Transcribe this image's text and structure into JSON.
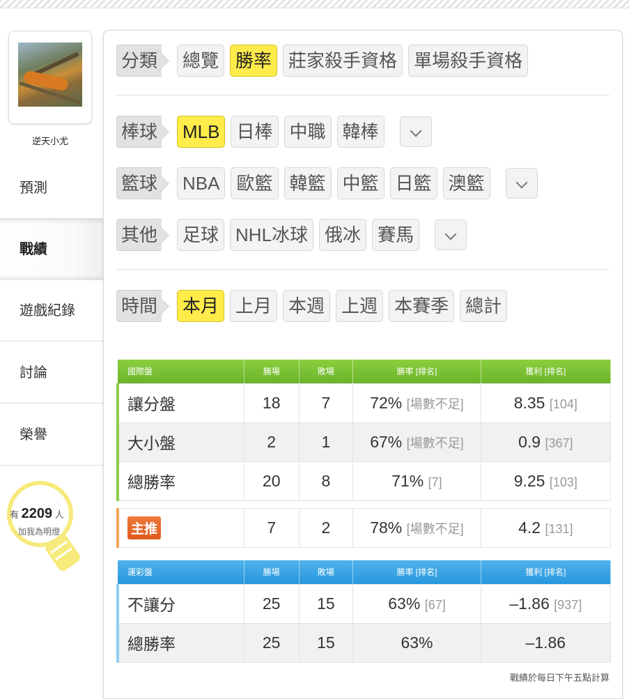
{
  "sidebar": {
    "username": "逆天小尤",
    "nav": [
      "預測",
      "戰績",
      "遊戲紀錄",
      "討論",
      "榮譽"
    ],
    "light": {
      "prefix": "有",
      "count": "2209",
      "suffix": "人",
      "caption": "加我為明燈"
    }
  },
  "filters": {
    "category": {
      "label": "分類",
      "options": [
        "總覽",
        "勝率",
        "莊家殺手資格",
        "單場殺手資格"
      ],
      "active": "勝率"
    },
    "baseball": {
      "label": "棒球",
      "options": [
        "MLB",
        "日棒",
        "中職",
        "韓棒"
      ],
      "active": "MLB"
    },
    "basketball": {
      "label": "籃球",
      "options": [
        "NBA",
        "歐籃",
        "韓籃",
        "中籃",
        "日籃",
        "澳籃"
      ]
    },
    "other": {
      "label": "其他",
      "options": [
        "足球",
        "NHL冰球",
        "俄冰",
        "賽馬"
      ]
    },
    "time": {
      "label": "時間",
      "options": [
        "本月",
        "上月",
        "本週",
        "上週",
        "本賽季",
        "總計"
      ],
      "active": "本月"
    }
  },
  "intl_table": {
    "headers": [
      "國際盤",
      "勝場",
      "敗場",
      "勝率 [排名]",
      "獲利 [排名]"
    ],
    "rows": [
      {
        "name": "讓分盤",
        "win": "18",
        "loss": "7",
        "rate": "72%",
        "rate_rank": "[場數不足]",
        "profit": "8.35",
        "profit_rank": "[104]"
      },
      {
        "name": "大小盤",
        "win": "2",
        "loss": "1",
        "rate": "67%",
        "rate_rank": "[場數不足]",
        "profit": "0.9",
        "profit_rank": "[367]"
      },
      {
        "name": "總勝率",
        "win": "20",
        "loss": "8",
        "rate": "71%",
        "rate_rank": "[7]",
        "profit": "9.25",
        "profit_rank": "[103]"
      }
    ]
  },
  "featured": {
    "badge": "主推",
    "win": "7",
    "loss": "2",
    "rate": "78%",
    "rate_rank": "[場數不足]",
    "profit": "4.2",
    "profit_rank": "[131]"
  },
  "lottery_table": {
    "headers": [
      "運彩盤",
      "勝場",
      "敗場",
      "勝率 [排名]",
      "獲利 [排名]"
    ],
    "rows": [
      {
        "name": "不讓分",
        "win": "25",
        "loss": "15",
        "rate": "63%",
        "rate_rank": "[67]",
        "profit": "–1.86",
        "profit_rank": "[937]"
      },
      {
        "name": "總勝率",
        "win": "25",
        "loss": "15",
        "rate": "63%",
        "rate_rank": "",
        "profit": "–1.86",
        "profit_rank": ""
      }
    ]
  },
  "footnote": "戰績於每日下午五點計算",
  "colors": {
    "active_chip": "#ffeb4a",
    "intl_header": "#7bc134",
    "lottery_header": "#38a5e4",
    "featured_badge": "#e8662a",
    "bulb": "#f7ea7c"
  }
}
